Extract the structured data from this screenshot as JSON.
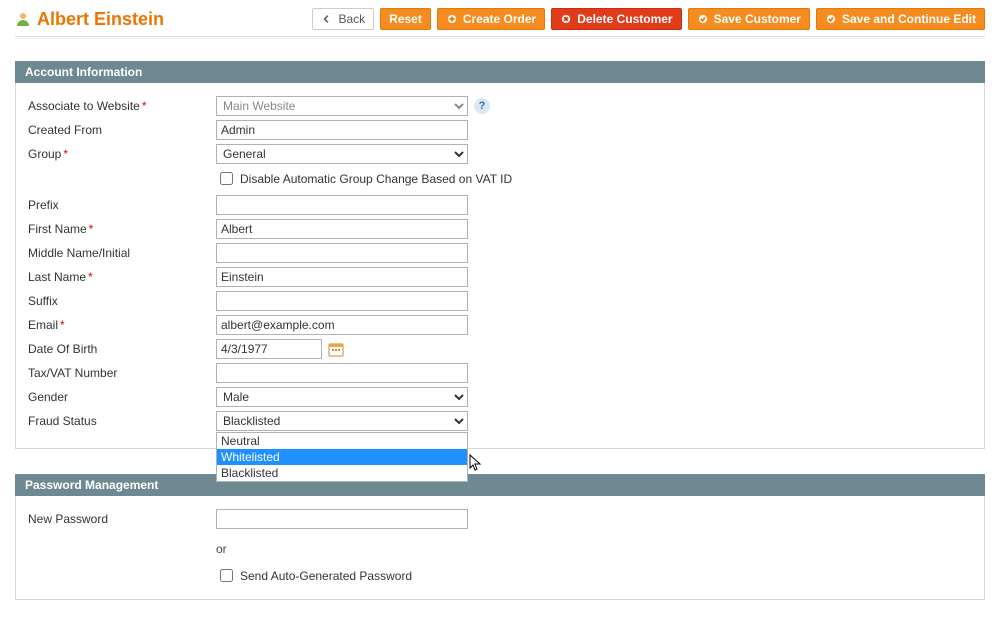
{
  "header": {
    "title": "Albert Einstein",
    "back_label": "Back",
    "reset_label": "Reset",
    "create_order_label": "Create Order",
    "delete_customer_label": "Delete Customer",
    "save_customer_label": "Save Customer",
    "save_continue_label": "Save and Continue Edit"
  },
  "sections": {
    "account_bar": "Account Information",
    "password_bar": "Password Management"
  },
  "fields": {
    "associate_label": "Associate to Website",
    "associate_value": "Main Website",
    "created_from_label": "Created From",
    "created_from_value": "Admin",
    "group_label": "Group",
    "group_value": "General",
    "group_checkbox_text": "Disable Automatic Group Change Based on VAT ID",
    "prefix_label": "Prefix",
    "prefix_value": "",
    "first_name_label": "First Name",
    "first_name_value": "Albert",
    "middle_label": "Middle Name/Initial",
    "middle_value": "",
    "last_name_label": "Last Name",
    "last_name_value": "Einstein",
    "suffix_label": "Suffix",
    "suffix_value": "",
    "email_label": "Email",
    "email_value": "albert@example.com",
    "dob_label": "Date Of Birth",
    "dob_value": "4/3/1977",
    "tax_label": "Tax/VAT Number",
    "tax_value": "",
    "gender_label": "Gender",
    "gender_value": "Male",
    "fraud_label": "Fraud Status",
    "fraud_value": "Blacklisted",
    "fraud_options": {
      "o1": "Neutral",
      "o2": "Whitelisted",
      "o3": "Blacklisted"
    },
    "new_password_label": "New Password",
    "new_password_value": "",
    "or_text": "or",
    "auto_pw_text": "Send Auto-Generated Password"
  }
}
